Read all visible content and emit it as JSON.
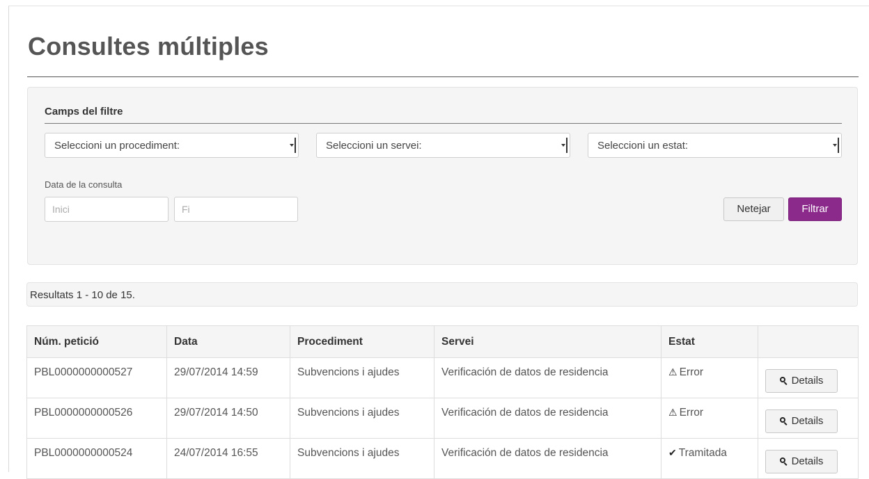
{
  "page": {
    "title": "Consultes múltiples"
  },
  "filter": {
    "legend": "Camps del filtre",
    "selects": [
      {
        "name": "procediment",
        "value": "Seleccioni un procediment:"
      },
      {
        "name": "servei",
        "value": "Seleccioni un servei:"
      },
      {
        "name": "estat",
        "value": "Seleccioni un estat:"
      }
    ],
    "date_label": "Data de la consulta",
    "date_start_placeholder": "Inici",
    "date_end_placeholder": "Fi",
    "clear_label": "Netejar",
    "filter_label": "Filtrar"
  },
  "results": {
    "summary": "Resultats 1 - 10 de 15.",
    "columns": [
      "Núm. petició",
      "Data",
      "Procediment",
      "Servei",
      "Estat",
      ""
    ],
    "details_label": "Details",
    "rows": [
      {
        "id": "PBL0000000000527",
        "date": "29/07/2014 14:59",
        "procedure": "Subvencions i ajudes",
        "service": "Verificación de datos de residencia",
        "status": "Error",
        "status_icon": "warning-icon"
      },
      {
        "id": "PBL0000000000526",
        "date": "29/07/2014 14:50",
        "procedure": "Subvencions i ajudes",
        "service": "Verificación de datos de residencia",
        "status": "Error",
        "status_icon": "warning-icon"
      },
      {
        "id": "PBL0000000000524",
        "date": "24/07/2014 16:55",
        "procedure": "Subvencions i ajudes",
        "service": "Verificación de datos de residencia",
        "status": "Tramitada",
        "status_icon": "check-icon"
      }
    ]
  },
  "colors": {
    "accent": "#8c2a8c",
    "panel_bg": "#f5f5f5"
  }
}
